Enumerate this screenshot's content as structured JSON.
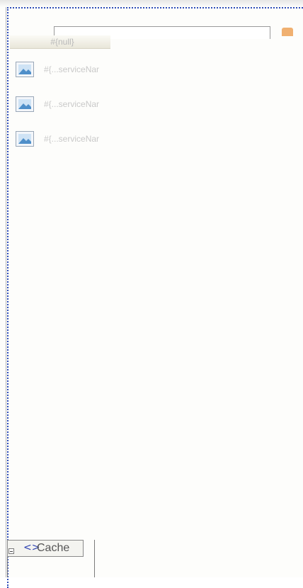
{
  "search": {
    "label": "",
    "value": "",
    "placeholder": ""
  },
  "table": {
    "header": "#{null}",
    "rows": [
      {
        "label": "#{...serviceNar"
      },
      {
        "label": "#{...serviceNar"
      },
      {
        "label": "#{...serviceNar"
      }
    ]
  },
  "cache": {
    "tag_icon": "<>",
    "label": "Cache"
  },
  "colors": {
    "frame": "#2d4cb8",
    "tag": "#2a3fb0",
    "text_faint": "#c9c9c9"
  }
}
